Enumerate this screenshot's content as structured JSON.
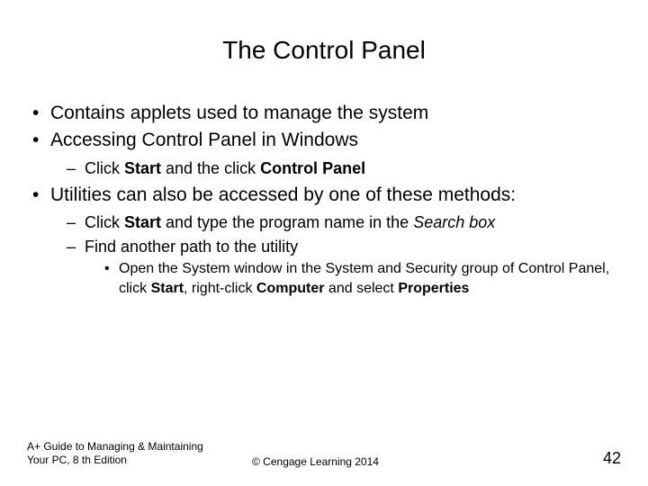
{
  "title": "The Control Panel",
  "b1": "Contains applets used to manage the system",
  "b2": "Accessing Control Panel in Windows",
  "b2_1_a": "Click ",
  "b2_1_b": "Start",
  "b2_1_c": " and the click ",
  "b2_1_d": "Control Panel",
  "b3": "Utilities can also be accessed by one of these methods:",
  "b3_1_a": "Click ",
  "b3_1_b": "Start",
  "b3_1_c": " and type the program name in the ",
  "b3_1_d": "Search box",
  "b3_2": "Find another path to the utility",
  "b3_2_1_a": "Open the System window in the System and Security group of Control Panel, click ",
  "b3_2_1_b": "Start",
  "b3_2_1_c": ", right-click ",
  "b3_2_1_d": "Computer",
  "b3_2_1_e": " and select ",
  "b3_2_1_f": "Properties",
  "footer_book": "A+ Guide to Managing & Maintaining Your PC, 8 th Edition",
  "footer_copy": "© Cengage Learning  2014",
  "footer_page": "42"
}
